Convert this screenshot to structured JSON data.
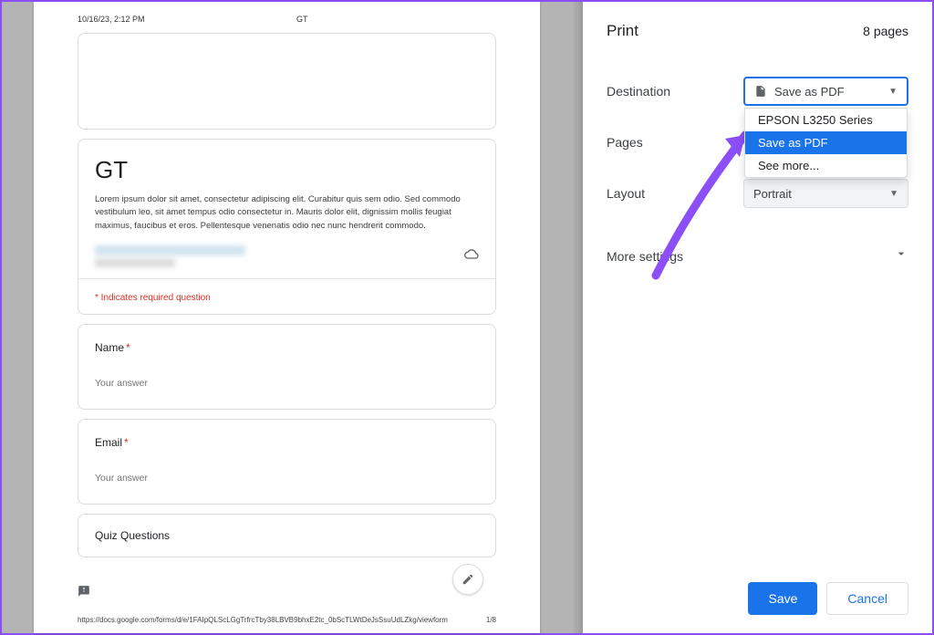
{
  "preview": {
    "timestamp": "10/16/23, 2:12 PM",
    "header_title": "GT",
    "form_title": "GT",
    "description": "Lorem ipsum dolor sit amet, consectetur adipiscing elit. Curabitur quis sem odio. Sed commodo vestibulum leo, sit amet tempus odio consectetur in. Mauris dolor elit, dignissim mollis feugiat maximus, faucibus et eros. Pellentesque venenatis odio nec nunc hendrerit commodo.",
    "required_notice": "* Indicates required question",
    "q1_label": "Name",
    "q2_label": "Email",
    "answer_placeholder": "Your answer",
    "section_label": "Quiz Questions",
    "footer_url": "https://docs.google.com/forms/d/e/1FAIpQLScLGgTrfrcTby38LBVB9bhxE2tc_0bScTLWtDeJsSsuUdLZkg/viewform",
    "page_num": "1/8"
  },
  "panel": {
    "title": "Print",
    "page_count": "8 pages",
    "labels": {
      "destination": "Destination",
      "pages": "Pages",
      "layout": "Layout",
      "more": "More settings"
    },
    "destination_value": "Save as PDF",
    "destination_options": [
      "EPSON L3250 Series",
      "Save as PDF",
      "See more..."
    ],
    "layout_value": "Portrait",
    "save": "Save",
    "cancel": "Cancel"
  }
}
